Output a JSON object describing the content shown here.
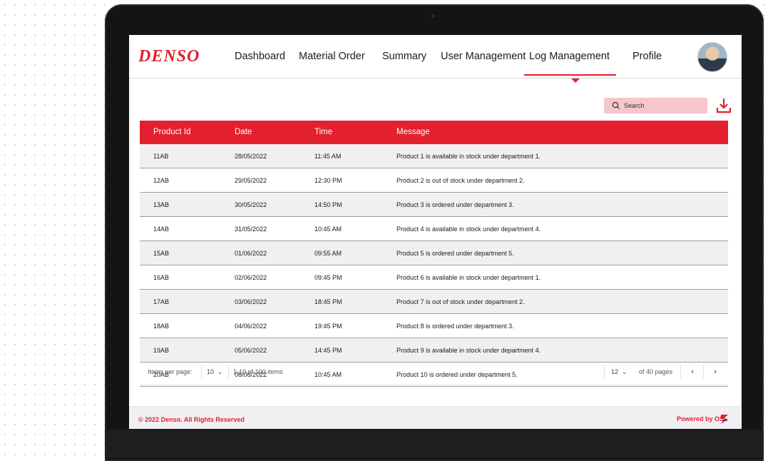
{
  "brand": {
    "logo_text": "DENSO",
    "accent_color": "#e3202e"
  },
  "nav": {
    "items": [
      {
        "label": "Dashboard"
      },
      {
        "label": "Material Order"
      },
      {
        "label": "Summary"
      },
      {
        "label": "User Management"
      },
      {
        "label": "Log Management",
        "active": true
      },
      {
        "label": "Profile"
      }
    ],
    "avatar_icon": "user-avatar-photo"
  },
  "toolbar": {
    "search_placeholder": "Search",
    "search_icon": "search-icon",
    "download_icon": "download-icon"
  },
  "table": {
    "columns": [
      "Product Id",
      "Date",
      "Time",
      "Message"
    ],
    "rows": [
      [
        "11AB",
        "28/05/2022",
        "11:45 AM",
        "Product 1 is available in stock under department 1."
      ],
      [
        "12AB",
        "29/05/2022",
        "12:30 PM",
        "Product 2 is out of stock under department 2."
      ],
      [
        "13AB",
        "30/05/2022",
        "14:50 PM",
        "Product 3 is ordered under department 3."
      ],
      [
        "14AB",
        "31/05/2022",
        "10:45 AM",
        "Product 4 is available in stock under department 4."
      ],
      [
        "15AB",
        "01/06/2022",
        "09:55 AM",
        "Product 5 is ordered under department 5."
      ],
      [
        "16AB",
        "02/06/2022",
        "09:45 PM",
        "Product 6 is available in stock under department 1."
      ],
      [
        "17AB",
        "03/06/2022",
        "18:45 PM",
        "Product 7 is out of stock under department 2."
      ],
      [
        "18AB",
        "04/06/2022",
        "19:45 PM",
        "Product 8 is ordered under department 3."
      ],
      [
        "19AB",
        "05/06/2022",
        "14:45 PM",
        "Product 9 is available in stock under department 4."
      ],
      [
        "20AB",
        "06/06/2022",
        "10:45 AM",
        "Product 10 is ordered under department 5."
      ]
    ]
  },
  "pagination": {
    "items_per_page_label": "Items per page:",
    "items_per_page_value": "10",
    "range_text": "1-10 of 100 items",
    "page_value": "12",
    "pages_text": "of 40 pages",
    "prev_icon": "chevron-left-icon",
    "next_icon": "chevron-right-icon"
  },
  "footer": {
    "copyright": "© 2022 Denso. All Rights Reserved",
    "powered_by": "Powered by OSL"
  }
}
